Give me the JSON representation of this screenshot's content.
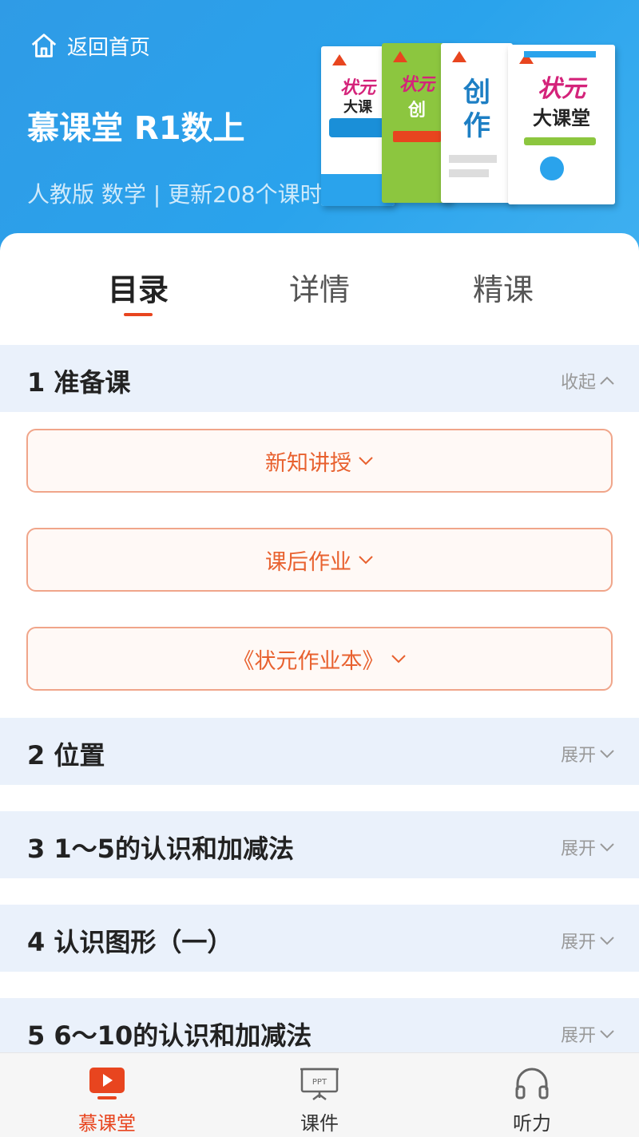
{
  "header": {
    "back_label": "返回首页",
    "title": "慕课堂 R1数上",
    "subtitle": "人教版 数学 | 更新208个课时",
    "books": [
      {
        "title": "状元",
        "sub": "大课",
        "color": "#ffffff"
      },
      {
        "title": "状元",
        "sub": "创",
        "color": "#8cc63f"
      },
      {
        "title": "创",
        "sub": "作",
        "color": "#ffffff"
      },
      {
        "title": "状元",
        "sub": "大课堂",
        "color": "#ffffff"
      }
    ]
  },
  "tabs": [
    "目录",
    "详情",
    "精课"
  ],
  "sections": [
    {
      "title": "1 准备课",
      "toggle": "收起"
    },
    {
      "title": "2 位置",
      "toggle": "展开"
    },
    {
      "title": "3 1～5的认识和加减法",
      "toggle": "展开"
    },
    {
      "title": "4 认识图形（一）",
      "toggle": "展开"
    },
    {
      "title": "5 6～10的认识和加减法",
      "toggle": "展开"
    }
  ],
  "lessons": [
    "新知讲授",
    "课后作业",
    "《状元作业本》"
  ],
  "nav": [
    {
      "label": "慕课堂",
      "icon": "video-play-icon"
    },
    {
      "label": "课件",
      "icon": "ppt-icon"
    },
    {
      "label": "听力",
      "icon": "headphones-icon"
    }
  ],
  "colors": {
    "accent": "#e8451f",
    "header_blue": "#2aa3ec",
    "section_bg": "#eaf1fb"
  }
}
